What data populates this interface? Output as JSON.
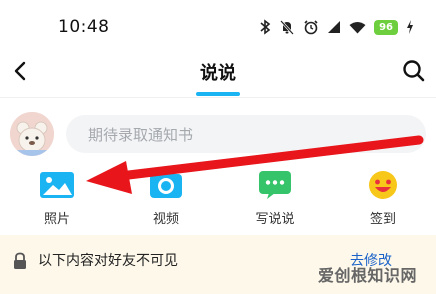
{
  "status": {
    "time": "10:48",
    "battery": "96"
  },
  "nav": {
    "title": "说说"
  },
  "compose": {
    "placeholder": "期待录取通知书"
  },
  "actions": [
    {
      "label": "照片",
      "icon": "photo-icon",
      "color": "#1bb4f2"
    },
    {
      "label": "视频",
      "icon": "video-camera-icon",
      "color": "#1bb4f2"
    },
    {
      "label": "写说说",
      "icon": "chat-icon",
      "color": "#35c46a"
    },
    {
      "label": "签到",
      "icon": "smiley-icon",
      "color": "#f7c719"
    }
  ],
  "notice": {
    "text": "以下内容对好友不可见",
    "link": "去修改"
  },
  "annotation": {
    "arrow_color": "#e8151b"
  },
  "watermark": "爱创根知识网"
}
